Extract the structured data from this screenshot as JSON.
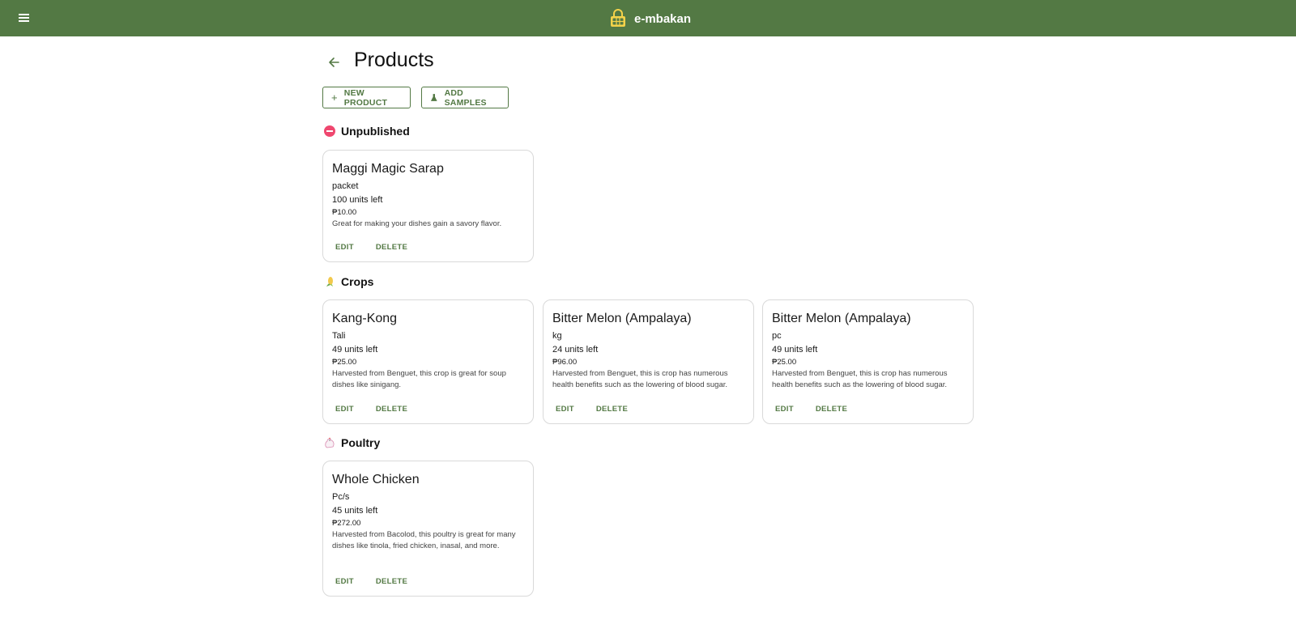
{
  "app": {
    "name": "e-mbakan"
  },
  "page": {
    "title": "Products"
  },
  "actions": {
    "new_product": "NEW PRODUCT",
    "add_samples": "ADD SAMPLES"
  },
  "sections": [
    {
      "title": "Unpublished",
      "icon": "no-entry-icon",
      "products": [
        {
          "name": "Maggi Magic Sarap",
          "unit": "packet",
          "stock": "100 units left",
          "price": "₱10.00",
          "description": "Great for making your dishes gain a savory flavor.",
          "edit": "EDIT",
          "delete": "DELETE"
        }
      ]
    },
    {
      "title": "Crops",
      "icon": "corn-icon",
      "products": [
        {
          "name": "Kang-Kong",
          "unit": "Tali",
          "stock": "49 units left",
          "price": "₱25.00",
          "description": "Harvested from Benguet, this crop is great for soup dishes like sinigang.",
          "edit": "EDIT",
          "delete": "DELETE"
        },
        {
          "name": "Bitter Melon (Ampalaya)",
          "unit": "kg",
          "stock": "24 units left",
          "price": "₱96.00",
          "description": "Harvested from Benguet, this is crop has numerous health benefits such as the lowering of blood sugar.",
          "edit": "EDIT",
          "delete": "DELETE"
        },
        {
          "name": "Bitter Melon (Ampalaya)",
          "unit": "pc",
          "stock": "49 units left",
          "price": "₱25.00",
          "description": "Harvested from Benguet, this is crop has numerous health benefits such as the lowering of blood sugar.",
          "edit": "EDIT",
          "delete": "DELETE"
        }
      ]
    },
    {
      "title": "Poultry",
      "icon": "chicken-icon",
      "products": [
        {
          "name": "Whole Chicken",
          "unit": "Pc/s",
          "stock": "45 units left",
          "price": "₱272.00",
          "description": "Harvested from Bacolod, this poultry is great for many dishes like tinola, fried chicken, inasal, and more.",
          "edit": "EDIT",
          "delete": "DELETE"
        }
      ]
    }
  ],
  "colors": {
    "primary": "#537944",
    "unpublished_icon": "#ef476f"
  }
}
